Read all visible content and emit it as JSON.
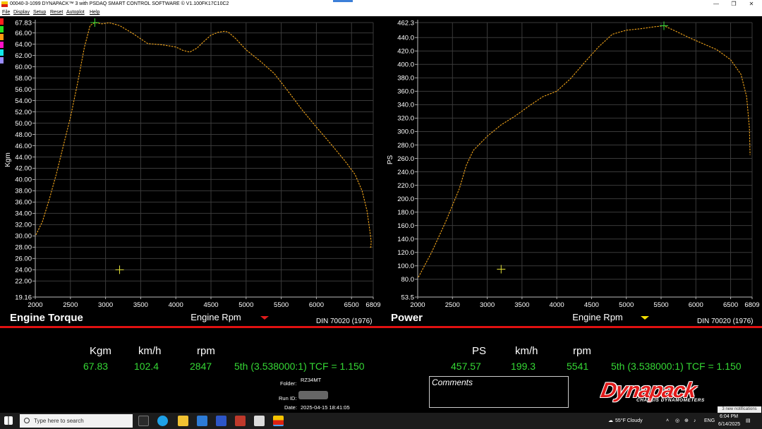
{
  "window": {
    "title": "00040-3-1099 DYNAPACK™ 3 with PSDAQ SMART CONTROL SOFTWARE © V1.100FK17C10C2",
    "controls": [
      "—",
      "❐",
      "✕"
    ]
  },
  "menu": [
    "File",
    "Display",
    "Setup",
    "Reset",
    "Autoplot",
    "Help"
  ],
  "swatch_colors": [
    "#ff1f1f",
    "#22e322",
    "#ff9a10",
    "#ff10c8",
    "#10e8e8",
    "#9a8cff"
  ],
  "colors": {
    "curve": "#f3a51a",
    "peak_marker": "#3fe03f",
    "cursor": "#e4e23a",
    "grid": "#3a3a3a",
    "axis_text": "#ffffff",
    "indicator_torque": "#e21b1b",
    "indicator_power": "#f5e000"
  },
  "chart_data": [
    {
      "type": "line",
      "title": "Engine Torque",
      "xlabel": "Engine Rpm",
      "ylabel": "Kgm",
      "standard": "DIN 70020 (1976)",
      "xlim": [
        2000,
        6809
      ],
      "ylim": [
        19.16,
        67.83
      ],
      "xticks": [
        "2000",
        "2500",
        "3000",
        "3500",
        "4000",
        "4500",
        "5000",
        "5500",
        "6000",
        "6500",
        "6809"
      ],
      "xtick_values": [
        2000,
        2500,
        3000,
        3500,
        4000,
        4500,
        5000,
        5500,
        6000,
        6500,
        6809
      ],
      "yticks": [
        "19.16",
        "22.00",
        "24.00",
        "26.00",
        "28.00",
        "30.00",
        "32.00",
        "34.00",
        "36.00",
        "38.00",
        "40.00",
        "42.00",
        "44.00",
        "46.00",
        "48.00",
        "50.00",
        "52.00",
        "54.00",
        "56.00",
        "58.00",
        "60.00",
        "62.00",
        "64.00",
        "66.00",
        "67.83"
      ],
      "ytick_values": [
        19.16,
        22,
        24,
        26,
        28,
        30,
        32,
        34,
        36,
        38,
        40,
        42,
        44,
        46,
        48,
        50,
        52,
        54,
        56,
        58,
        60,
        62,
        64,
        66,
        67.83
      ],
      "x": [
        2010,
        2100,
        2200,
        2300,
        2400,
        2500,
        2600,
        2700,
        2780,
        2847,
        2950,
        3050,
        3200,
        3400,
        3600,
        3800,
        4000,
        4100,
        4200,
        4300,
        4400,
        4500,
        4600,
        4700,
        4750,
        4850,
        5000,
        5200,
        5400,
        5600,
        5800,
        6000,
        6200,
        6400,
        6550,
        6650,
        6720,
        6760,
        6780,
        6775,
        6760
      ],
      "y": [
        30.2,
        32.5,
        36.5,
        41.0,
        46.0,
        51.0,
        57.0,
        63.5,
        67.3,
        67.83,
        67.6,
        67.8,
        67.3,
        65.8,
        64.1,
        63.9,
        63.5,
        62.9,
        62.6,
        63.3,
        64.5,
        65.6,
        66.1,
        66.3,
        66.1,
        65.0,
        63.0,
        61.0,
        58.8,
        55.6,
        52.3,
        49.3,
        46.4,
        43.4,
        40.9,
        38.0,
        34.5,
        31.0,
        29.0,
        28.0,
        28.0
      ],
      "peak": {
        "x": 2847,
        "y": 67.83
      },
      "cursor": {
        "x": 3200,
        "y": 24.0
      }
    },
    {
      "type": "line",
      "title": "Power",
      "xlabel": "Engine Rpm",
      "ylabel": "PS",
      "standard": "DIN 70020 (1976)",
      "xlim": [
        2000,
        6809
      ],
      "ylim": [
        53.5,
        462.3
      ],
      "xticks": [
        "2000",
        "2500",
        "3000",
        "3500",
        "4000",
        "4500",
        "5000",
        "5500",
        "6000",
        "6500",
        "6809"
      ],
      "xtick_values": [
        2000,
        2500,
        3000,
        3500,
        4000,
        4500,
        5000,
        5500,
        6000,
        6500,
        6809
      ],
      "yticks": [
        "53.5",
        "80.0",
        "100.0",
        "120.0",
        "140.0",
        "160.0",
        "180.0",
        "200.0",
        "220.0",
        "240.0",
        "260.0",
        "280.0",
        "300.0",
        "320.0",
        "340.0",
        "360.0",
        "380.0",
        "400.0",
        "420.0",
        "440.0",
        "462.3"
      ],
      "ytick_values": [
        53.5,
        80,
        100,
        120,
        140,
        160,
        180,
        200,
        220,
        240,
        260,
        280,
        300,
        320,
        340,
        360,
        380,
        400,
        420,
        440,
        462.3
      ],
      "x": [
        2010,
        2200,
        2400,
        2600,
        2700,
        2800,
        3000,
        3200,
        3400,
        3600,
        3800,
        4000,
        4200,
        4400,
        4600,
        4800,
        5000,
        5200,
        5400,
        5541,
        5700,
        5900,
        6100,
        6300,
        6500,
        6650,
        6730,
        6770,
        6780
      ],
      "y": [
        83,
        120,
        165,
        215,
        250,
        272,
        293,
        310,
        323,
        338,
        352,
        360,
        379,
        403,
        426,
        445,
        451,
        453,
        456,
        457.57,
        450,
        440,
        431,
        422,
        407,
        385,
        352,
        305,
        265
      ],
      "peak": {
        "x": 5541,
        "y": 457.57
      },
      "cursor": {
        "x": 3200,
        "y": 95.0
      }
    }
  ],
  "readout_left": {
    "headers": [
      "Kgm",
      "km/h",
      "rpm"
    ],
    "values": [
      "67.83",
      "102.4",
      "2847"
    ],
    "gear": "5th (3.538000:1) TCF = 1.150"
  },
  "readout_right": {
    "headers": [
      "PS",
      "km/h",
      "rpm"
    ],
    "values": [
      "457.57",
      "199.3",
      "5541"
    ],
    "gear": "5th (3.538000:1) TCF = 1.150"
  },
  "run_info": {
    "folder_label": "Folder:",
    "folder_value": "RZ34MT",
    "runid_label": "Run ID:",
    "date_label": "Date:",
    "date_value": "2025-04-15 18:41:05"
  },
  "comments_label": "Comments",
  "logo": {
    "text": "Dynapack",
    "subtitle": "CHASSIS DYNAMOMETERS"
  },
  "notification": "3 new notifications",
  "taskbar": {
    "search_placeholder": "Type here to search",
    "weather": "55°F  Cloudy",
    "lang": "ENG",
    "time": "6:04 PM",
    "date": "6/14/2025"
  }
}
